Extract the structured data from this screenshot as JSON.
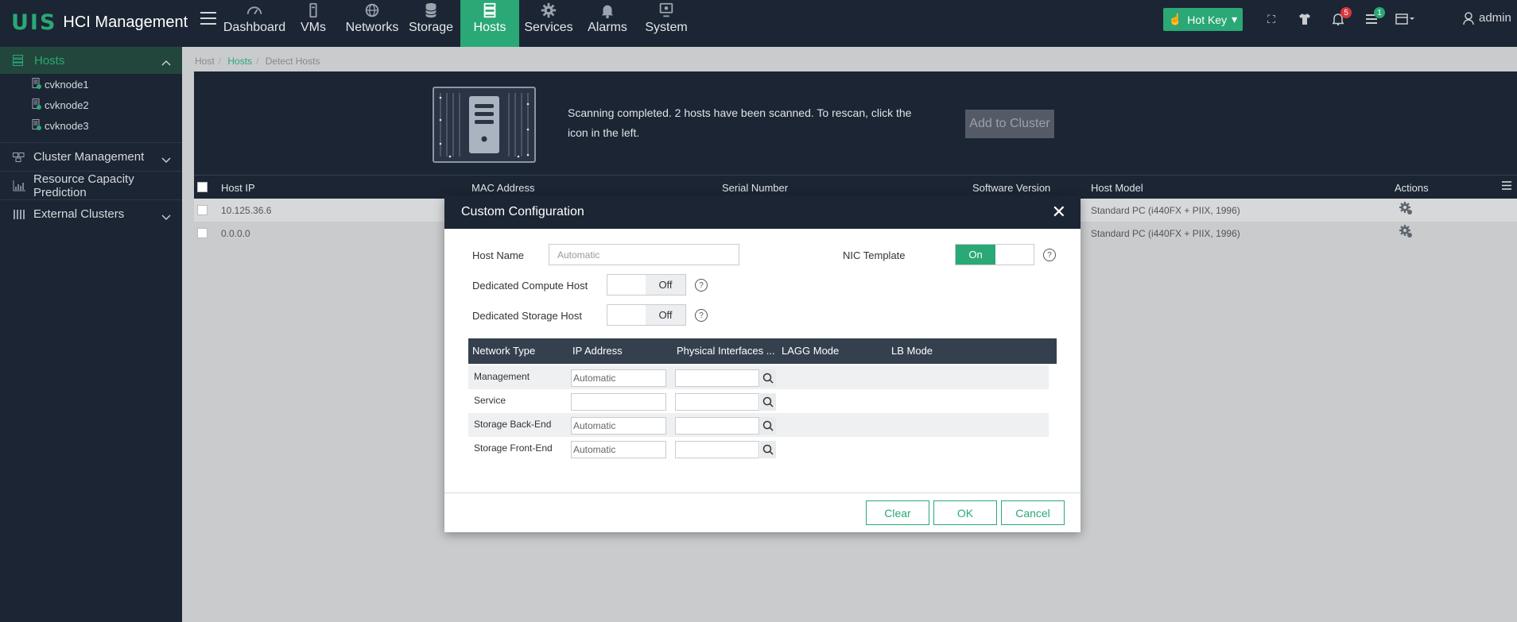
{
  "app": {
    "logo": "UIS",
    "title": "HCI Management"
  },
  "nav": [
    {
      "label": "Dashboard",
      "icon": "dashboard-icon"
    },
    {
      "label": "VMs",
      "icon": "vm-icon"
    },
    {
      "label": "Networks",
      "icon": "globe-icon"
    },
    {
      "label": "Storage",
      "icon": "database-icon"
    },
    {
      "label": "Hosts",
      "icon": "server-icon",
      "active": true
    },
    {
      "label": "Services",
      "icon": "gear-icon"
    },
    {
      "label": "Alarms",
      "icon": "bell-icon"
    },
    {
      "label": "System",
      "icon": "monitor-icon"
    }
  ],
  "topright": {
    "hotkey": "Hot Key",
    "alarm_count": "5",
    "task_count": "1",
    "user": "admin"
  },
  "sidebar": {
    "hosts_label": "Hosts",
    "hosts": [
      "cvknode1",
      "cvknode2",
      "cvknode3"
    ],
    "items": [
      "Cluster Management",
      "Resource Capacity Prediction",
      "External Clusters"
    ]
  },
  "breadcrumb": [
    "Host",
    "Hosts",
    "Detect Hosts"
  ],
  "scan": {
    "message": "Scanning completed. 2 hosts have been scanned. To rescan, click the icon in the left.",
    "add_button": "Add to Cluster"
  },
  "table": {
    "columns": [
      "Host IP",
      "MAC Address",
      "Serial Number",
      "Software Version",
      "Host Model",
      "Actions"
    ],
    "rows": [
      {
        "ip": "10.125.36.6",
        "model": "Standard PC (i440FX + PIIX, 1996)"
      },
      {
        "ip": "0.0.0.0",
        "model": "Standard PC (i440FX + PIIX, 1996)"
      }
    ]
  },
  "modal": {
    "title": "Custom Configuration",
    "host_name_label": "Host Name",
    "host_name_placeholder": "Automatic",
    "nic_template_label": "NIC Template",
    "nic_template_state": "On",
    "compute_label": "Dedicated Compute Host",
    "compute_state": "Off",
    "storage_label": "Dedicated Storage Host",
    "storage_state": "Off",
    "net_columns": [
      "Network Type",
      "IP Address",
      "Physical Interfaces ...",
      "LAGG Mode",
      "LB Mode"
    ],
    "net_rows": [
      {
        "type": "Management",
        "ip": "Automatic"
      },
      {
        "type": "Service",
        "ip": ""
      },
      {
        "type": "Storage Back-End",
        "ip": "Automatic"
      },
      {
        "type": "Storage Front-End",
        "ip": "Automatic"
      }
    ],
    "clear": "Clear",
    "ok": "OK",
    "cancel": "Cancel"
  },
  "colors": {
    "accent": "#2aa876",
    "dark": "#1c2533",
    "badge_red": "#d9363e"
  }
}
